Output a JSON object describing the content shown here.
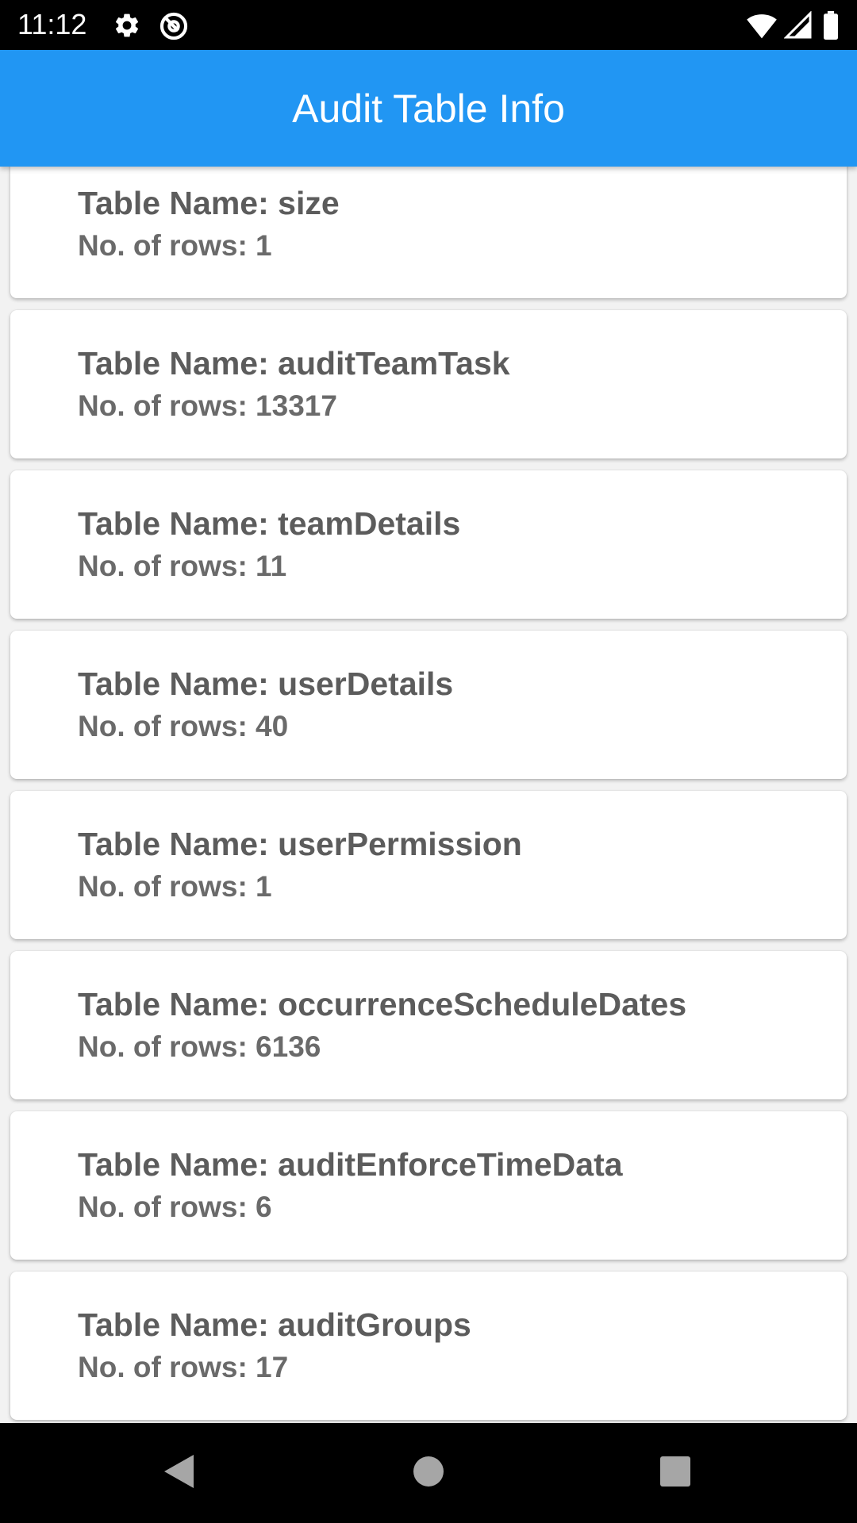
{
  "status_bar": {
    "time": "11:12",
    "icons": [
      "gear-icon",
      "at-sign-icon",
      "wifi-icon",
      "signal-icon",
      "battery-icon"
    ]
  },
  "app_bar": {
    "title": "Audit Table Info",
    "color": "#2196f3"
  },
  "tables": [
    {
      "name_label": "Table Name: size",
      "rows_label": "No. of rows: 1"
    },
    {
      "name_label": "Table Name: auditTeamTask",
      "rows_label": "No. of rows: 13317"
    },
    {
      "name_label": "Table Name: teamDetails",
      "rows_label": "No. of rows: 11"
    },
    {
      "name_label": "Table Name: userDetails",
      "rows_label": "No. of rows: 40"
    },
    {
      "name_label": "Table Name: userPermission",
      "rows_label": "No. of rows: 1"
    },
    {
      "name_label": "Table Name: occurrenceScheduleDates",
      "rows_label": "No. of rows: 6136"
    },
    {
      "name_label": "Table Name: auditEnforceTimeData",
      "rows_label": "No. of rows: 6"
    },
    {
      "name_label": "Table Name: auditGroups",
      "rows_label": "No. of rows: 17"
    }
  ],
  "nav_bar": {
    "buttons": [
      "back-icon",
      "home-icon",
      "recents-icon"
    ]
  }
}
